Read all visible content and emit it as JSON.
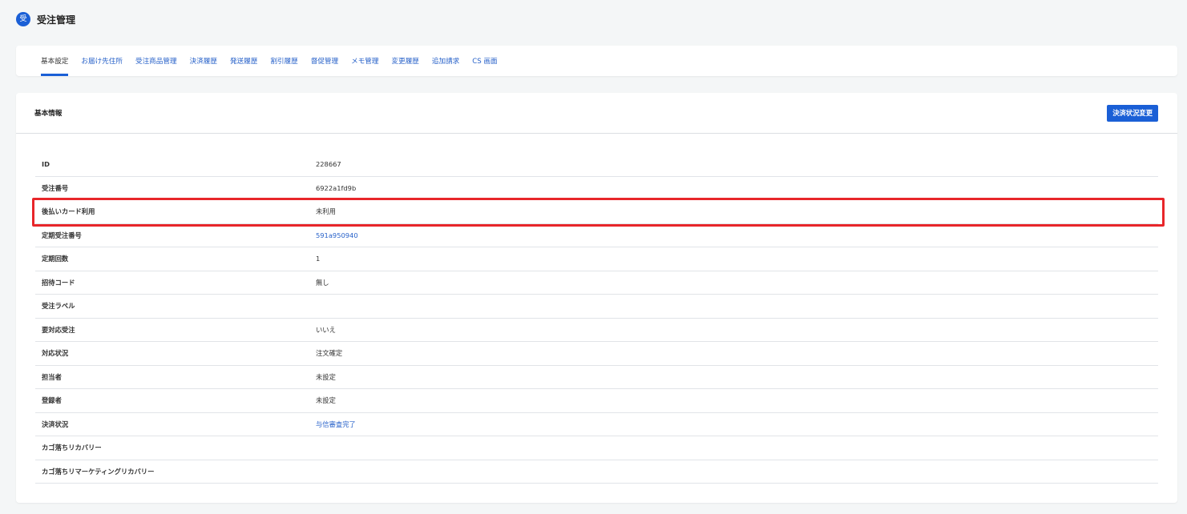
{
  "header": {
    "icon_glyph": "受",
    "title": "受注管理"
  },
  "tabs": [
    {
      "label": "基本設定",
      "active": true
    },
    {
      "label": "お届け先住所",
      "active": false
    },
    {
      "label": "受注商品管理",
      "active": false
    },
    {
      "label": "決済履歴",
      "active": false
    },
    {
      "label": "発送履歴",
      "active": false
    },
    {
      "label": "割引履歴",
      "active": false
    },
    {
      "label": "督促管理",
      "active": false
    },
    {
      "label": "メモ管理",
      "active": false
    },
    {
      "label": "変更履歴",
      "active": false
    },
    {
      "label": "追加請求",
      "active": false
    },
    {
      "label": "CS 画面",
      "active": false
    }
  ],
  "card": {
    "title": "基本情報",
    "action_label": "決済状況変更"
  },
  "rows": [
    {
      "label": "ID",
      "value": "228667",
      "link": false
    },
    {
      "label": "受注番号",
      "value": "6922a1fd9b",
      "link": false
    },
    {
      "label": "後払いカード利用",
      "value": "未利用",
      "link": false
    },
    {
      "label": "定期受注番号",
      "value": "591a950940",
      "link": true
    },
    {
      "label": "定期回数",
      "value": "1",
      "link": false
    },
    {
      "label": "招待コード",
      "value": "無し",
      "link": false
    },
    {
      "label": "受注ラベル",
      "value": "",
      "link": false
    },
    {
      "label": "要対応受注",
      "value": "いいえ",
      "link": false
    },
    {
      "label": "対応状況",
      "value": "注文確定",
      "link": false
    },
    {
      "label": "担当者",
      "value": "未設定",
      "link": false
    },
    {
      "label": "登録者",
      "value": "未設定",
      "link": false
    },
    {
      "label": "決済状況",
      "value": "与信審査完了",
      "link": true
    },
    {
      "label": "カゴ落ちリカバリー",
      "value": "",
      "link": false
    },
    {
      "label": "カゴ落ちリマーケティングリカバリー",
      "value": "",
      "link": false
    }
  ],
  "colors": {
    "accent": "#1a5fd6",
    "link": "#2761c9",
    "highlight": "#e8262a",
    "background": "#f4f6f7"
  }
}
